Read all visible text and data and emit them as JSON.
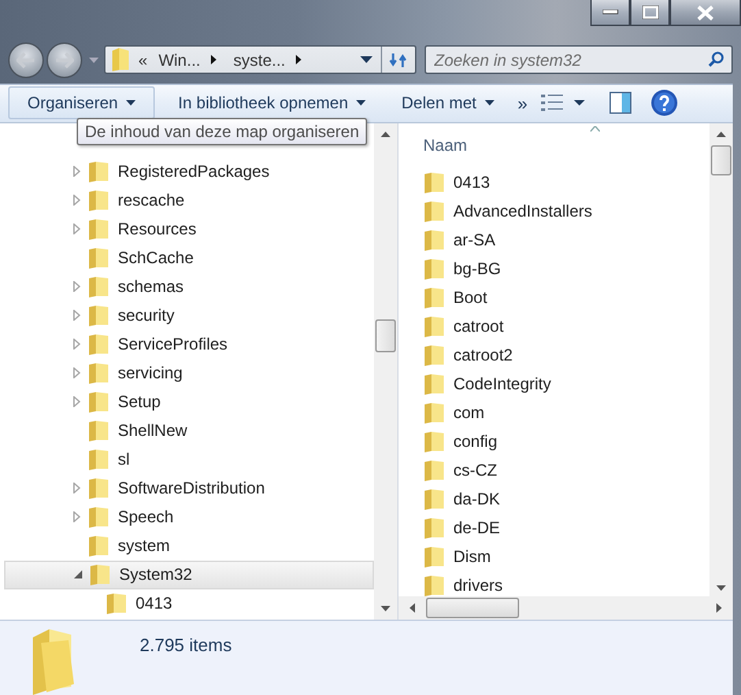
{
  "address_bar": {
    "overflow": "«",
    "segments": [
      "Win...",
      "syste..."
    ]
  },
  "search": {
    "placeholder": "Zoeken in system32"
  },
  "toolbar": {
    "buttons": [
      {
        "label": "Organiseren",
        "highlighted": true
      },
      {
        "label": "In bibliotheek opnemen",
        "highlighted": false
      },
      {
        "label": "Delen met",
        "highlighted": false
      }
    ],
    "overflow": "»"
  },
  "tooltip": {
    "text": "De inhoud van deze map organiseren"
  },
  "tree": {
    "items": [
      {
        "label": "RegisteredPackages",
        "expandable": true,
        "expanded": false,
        "selected": false
      },
      {
        "label": "rescache",
        "expandable": true,
        "expanded": false,
        "selected": false
      },
      {
        "label": "Resources",
        "expandable": true,
        "expanded": false,
        "selected": false
      },
      {
        "label": "SchCache",
        "expandable": false,
        "selected": false
      },
      {
        "label": "schemas",
        "expandable": true,
        "expanded": false,
        "selected": false
      },
      {
        "label": "security",
        "expandable": true,
        "expanded": false,
        "selected": false
      },
      {
        "label": "ServiceProfiles",
        "expandable": true,
        "expanded": false,
        "selected": false
      },
      {
        "label": "servicing",
        "expandable": true,
        "expanded": false,
        "selected": false
      },
      {
        "label": "Setup",
        "expandable": true,
        "expanded": false,
        "selected": false
      },
      {
        "label": "ShellNew",
        "expandable": false,
        "selected": false
      },
      {
        "label": "sl",
        "expandable": false,
        "selected": false
      },
      {
        "label": "SoftwareDistribution",
        "expandable": true,
        "expanded": false,
        "selected": false
      },
      {
        "label": "Speech",
        "expandable": true,
        "expanded": false,
        "selected": false
      },
      {
        "label": "system",
        "expandable": false,
        "selected": false
      },
      {
        "label": "System32",
        "expandable": true,
        "expanded": true,
        "selected": true,
        "children": [
          {
            "label": "0413",
            "expandable": false,
            "selected": false
          }
        ]
      }
    ]
  },
  "file_list": {
    "column": {
      "label": "Naam",
      "sorted": true
    },
    "items": [
      "0413",
      "AdvancedInstallers",
      "ar-SA",
      "bg-BG",
      "Boot",
      "catroot",
      "catroot2",
      "CodeIntegrity",
      "com",
      "config",
      "cs-CZ",
      "da-DK",
      "de-DE",
      "Dism",
      "drivers"
    ]
  },
  "status_bar": {
    "count": "2.795 items"
  }
}
